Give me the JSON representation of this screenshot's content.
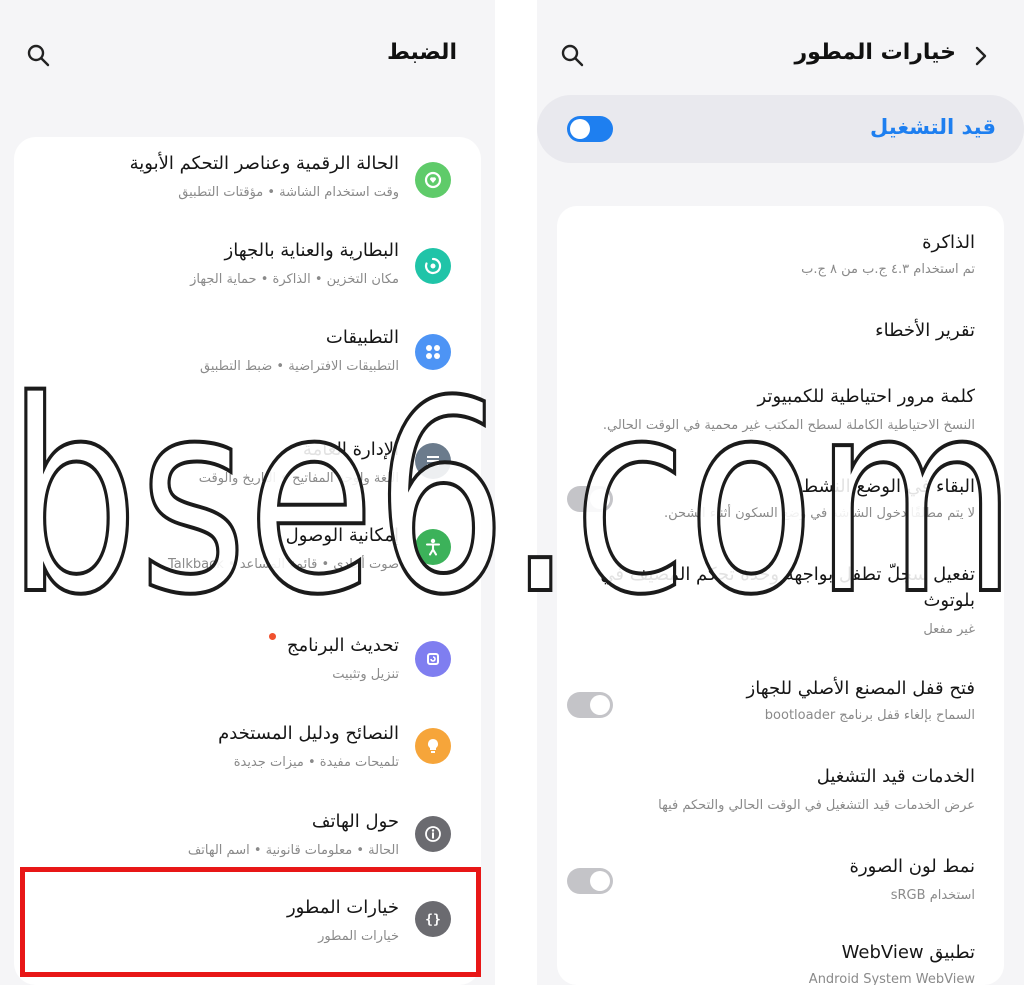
{
  "left": {
    "title": "الضبط",
    "items": [
      {
        "title": "الحالة الرقمية وعناصر التحكم الأبوية",
        "subtitle": "وقت استخدام الشاشة • مؤقتات التطبيق",
        "icon": "digital-wellbeing-icon",
        "color": "#5fcb6a"
      },
      {
        "title": "البطارية والعناية بالجهاز",
        "subtitle": "مكان التخزين • الذاكرة • حماية الجهاز",
        "icon": "device-care-icon",
        "color": "#20c4a8"
      },
      {
        "title": "التطبيقات",
        "subtitle": "التطبيقات الافتراضية • ضبط التطبيق",
        "icon": "apps-icon",
        "color": "#4d94f5"
      },
      {
        "title": "الإدارة العامة",
        "subtitle": "اللغة ولوحة المفاتيح • التاريخ والوقت",
        "icon": "general-management-icon",
        "color": "#6b7b8c"
      },
      {
        "title": "إمكانية الوصول",
        "subtitle": "صوت أحادي • قائمة المساعد • Talkback",
        "icon": "accessibility-icon",
        "color": "#3cb25a"
      },
      {
        "title": "تحديث البرنامج",
        "subtitle": "تنزيل وتثبيت",
        "icon": "software-update-icon",
        "color": "#7f7ef0"
      },
      {
        "title": "النصائح ودليل المستخدم",
        "subtitle": "تلميحات مفيدة • ميزات جديدة",
        "icon": "tips-bulb-icon",
        "color": "#f6a53a"
      },
      {
        "title": "حول الهاتف",
        "subtitle": "الحالة • معلومات قانونية • اسم الهاتف",
        "icon": "info-icon",
        "color": "#6b6b70"
      },
      {
        "title": "خيارات المطور",
        "subtitle": "خيارات المطور",
        "icon": "developer-braces-icon",
        "color": "#6b6b70"
      }
    ]
  },
  "right": {
    "title": "خيارات المطور",
    "master_label": "قيد التشغيل",
    "accent": "#1e7ff0",
    "items": [
      {
        "title": "الذاكرة",
        "subtitle": "تم استخدام ٤.٣ ج.ب من ٨ ج.ب"
      },
      {
        "title": "تقرير الأخطاء",
        "subtitle": ""
      },
      {
        "title": "كلمة مرور احتياطية للكمبيوتر",
        "subtitle": "النسخ الاحتياطية الكاملة لسطح المكتب غير محمية في الوقت الحالي."
      },
      {
        "title": "البقاء في الوضع النشط",
        "subtitle": "لا يتم مطلقًا دخول الشاشة في وضع السكون أثناء الشحن."
      },
      {
        "title": "تفعيل سجلّ تطفل بواجهة وحدة تحكم المضيف في",
        "title2": "بلوتوث",
        "subtitle": "غير مفعل"
      },
      {
        "title": "فتح قفل المصنع الأصلي للجهاز",
        "subtitle": "السماح بإلغاء قفل برنامج bootloader"
      },
      {
        "title": "الخدمات قيد التشغيل",
        "subtitle": "عرض الخدمات قيد التشغيل في الوقت الحالي والتحكم فيها"
      },
      {
        "title": "نمط لون الصورة",
        "subtitle": "استخدام sRGB"
      },
      {
        "title": "تطبيق WebView",
        "subtitle": "Android System WebView"
      }
    ]
  },
  "watermark": "bse6.com"
}
